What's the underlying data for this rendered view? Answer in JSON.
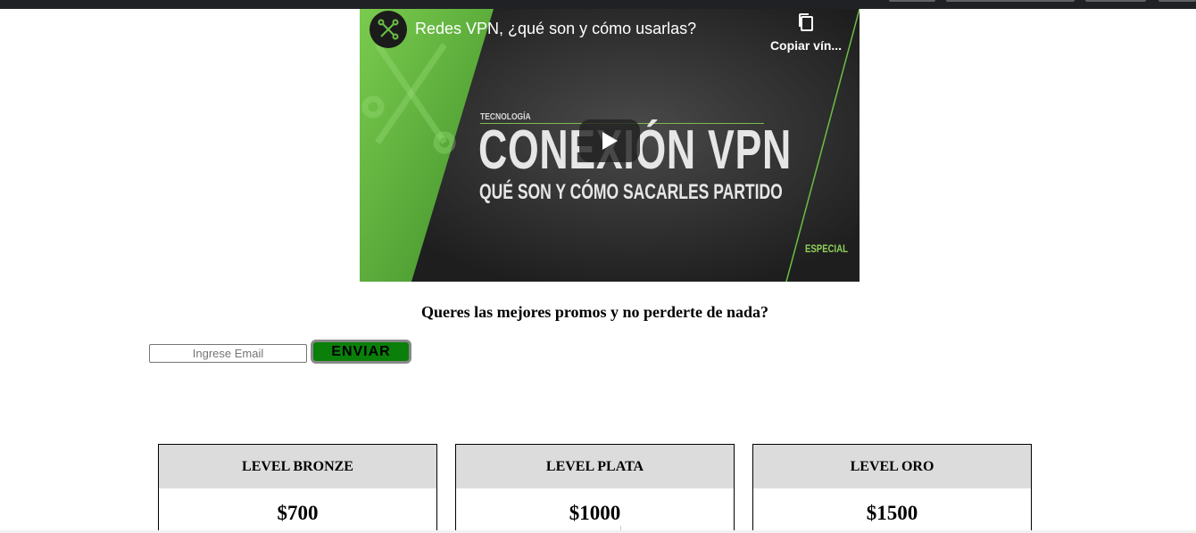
{
  "video": {
    "title": "Redes VPN, ¿qué son y cómo usarlas?",
    "copy_link_label": "Copiar vín...",
    "thumbnail": {
      "tag": "TECNOLOGÍA",
      "headline": "CONEXIÓN VPN",
      "subheadline": "QUÉ SON Y CÓMO SACARLES PARTIDO",
      "corner_label": "ESPECIAL"
    },
    "colors": {
      "accent_green": "#6abf45",
      "dark": "#2b2b2b"
    }
  },
  "promo": {
    "heading": "Queres las mejores promos y no perderte de nada?",
    "email_placeholder": "Ingrese Email",
    "submit_label": "ENVIAR",
    "submit_color": "#0a7f0a"
  },
  "pricing": {
    "plans": [
      {
        "name": "LEVEL BRONZE",
        "price": "$700"
      },
      {
        "name": "LEVEL PLATA",
        "price": "$1000"
      },
      {
        "name": "LEVEL ORO",
        "price": "$1500"
      }
    ]
  }
}
